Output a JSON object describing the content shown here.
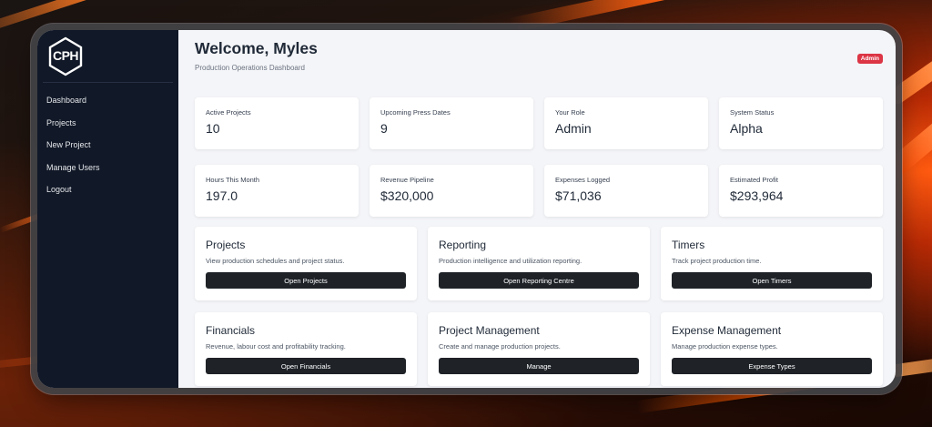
{
  "brand": {
    "logo_text": "CPH"
  },
  "sidebar": {
    "items": [
      {
        "label": "Dashboard"
      },
      {
        "label": "Projects"
      },
      {
        "label": "New Project"
      },
      {
        "label": "Manage Users"
      },
      {
        "label": "Logout"
      }
    ]
  },
  "header": {
    "title": "Welcome, Myles",
    "subtitle": "Production Operations Dashboard",
    "badge": "Admin"
  },
  "stats": [
    {
      "label": "Active Projects",
      "value": "10"
    },
    {
      "label": "Upcoming Press Dates",
      "value": "9"
    },
    {
      "label": "Your Role",
      "value": "Admin"
    },
    {
      "label": "System Status",
      "value": "Alpha"
    },
    {
      "label": "Hours This Month",
      "value": "197.0"
    },
    {
      "label": "Revenue Pipeline",
      "value": "$320,000"
    },
    {
      "label": "Expenses Logged",
      "value": "$71,036"
    },
    {
      "label": "Estimated Profit",
      "value": "$293,964"
    }
  ],
  "modules": [
    {
      "title": "Projects",
      "desc": "View production schedules and project status.",
      "button": "Open Projects"
    },
    {
      "title": "Reporting",
      "desc": "Production intelligence and utilization reporting.",
      "button": "Open Reporting Centre"
    },
    {
      "title": "Timers",
      "desc": "Track project production time.",
      "button": "Open Timers"
    },
    {
      "title": "Financials",
      "desc": "Revenue, labour cost and profitability tracking.",
      "button": "Open Financials"
    },
    {
      "title": "Project Management",
      "desc": "Create and manage production projects.",
      "button": "Manage"
    },
    {
      "title": "Expense Management",
      "desc": "Manage production expense types.",
      "button": "Expense Types"
    }
  ],
  "colors": {
    "sidebar": "#111827",
    "badge": "#dc3545",
    "button": "#1f2328",
    "content_bg": "#f4f5f8"
  }
}
